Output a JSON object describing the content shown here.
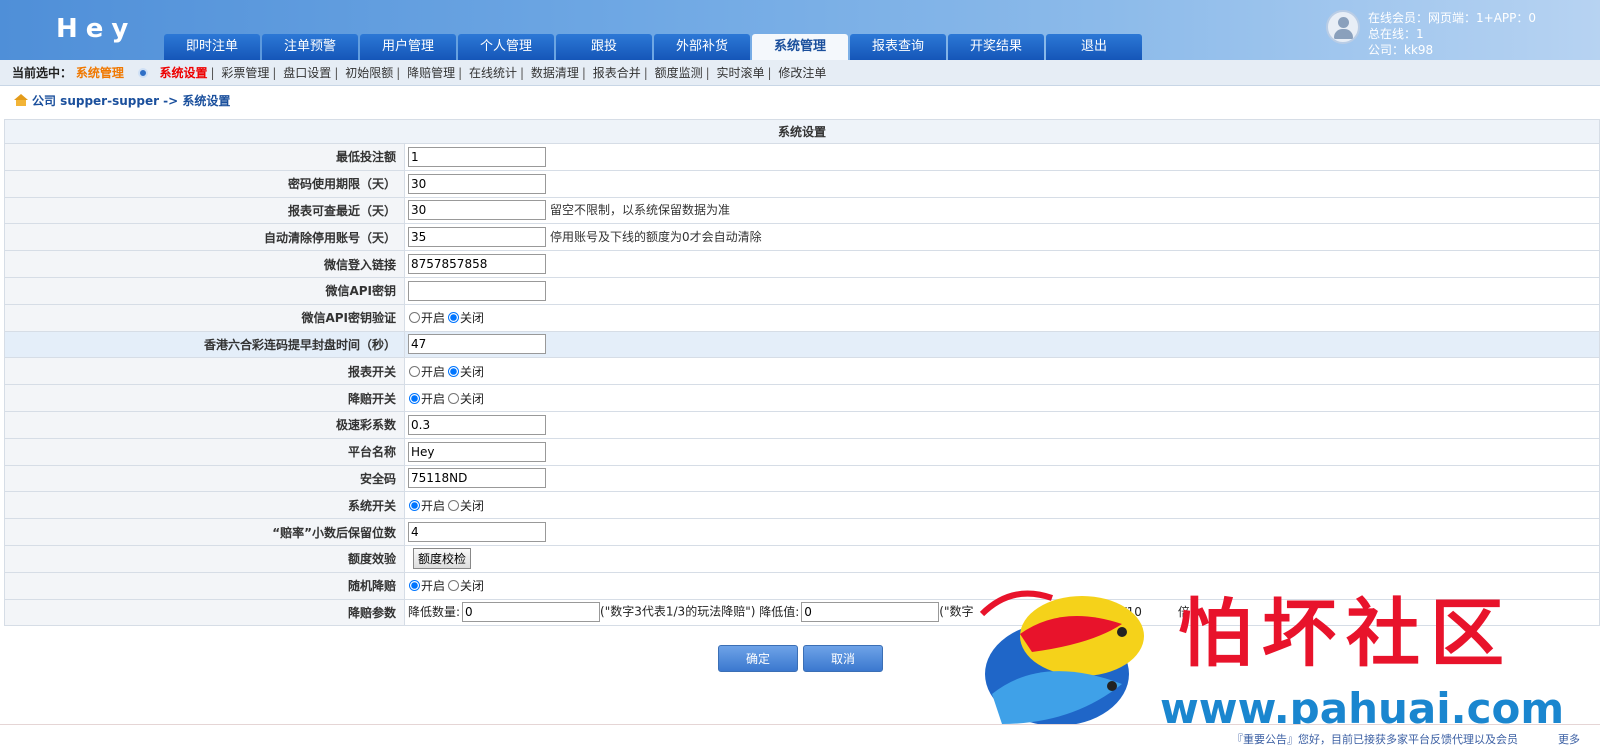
{
  "header": {
    "logo": "Hey",
    "nav_tabs": [
      "即时注单",
      "注单预警",
      "用户管理",
      "个人管理",
      "跟投",
      "外部补货",
      "系统管理",
      "报表查询",
      "开奖结果",
      "退出"
    ],
    "active_tab": "系统管理",
    "user_info": {
      "online_members": "在线会员：网页端：1+APP：0",
      "total_online": "总在线：1",
      "company": "公司：kk98"
    }
  },
  "subnav": {
    "current_label": "当前选中：",
    "current_value": "系统管理",
    "items": [
      "系统设置",
      "彩票管理",
      "盘口设置",
      "初始限额",
      "降赔管理",
      "在线统计",
      "数据清理",
      "报表合并",
      "额度监测",
      "实时滚单",
      "修改注单"
    ],
    "active_item": "系统设置"
  },
  "breadcrumb": "公司 supper-supper -> 系统设置",
  "settings": {
    "title": "系统设置",
    "rows": {
      "min_bet": {
        "label": "最低投注额",
        "value": "1"
      },
      "pwd_expire": {
        "label": "密码使用期限（天）",
        "value": "30"
      },
      "report_days": {
        "label": "报表可查最近（天）",
        "value": "30",
        "hint": "留空不限制，以系统保留数据为准"
      },
      "auto_clear": {
        "label": "自动清除停用账号（天）",
        "value": "35",
        "hint": "停用账号及下线的额度为0才会自动清除"
      },
      "wechat_link": {
        "label": "微信登入链接",
        "value": "8757857858"
      },
      "wechat_key": {
        "label": "微信API密钥",
        "value": ""
      },
      "wechat_verify": {
        "label": "微信API密钥验证",
        "on": "开启",
        "off": "关闭",
        "selected": "off"
      },
      "hk_close": {
        "label": "香港六合彩连码提早封盘时间（秒）",
        "value": "47"
      },
      "report_switch": {
        "label": "报表开关",
        "on": "开启",
        "off": "关闭",
        "selected": "off"
      },
      "odds_switch": {
        "label": "降赔开关",
        "on": "开启",
        "off": "关闭",
        "selected": "on"
      },
      "speed_factor": {
        "label": "极速彩系数",
        "value": "0.3"
      },
      "platform_name": {
        "label": "平台名称",
        "value": "Hey"
      },
      "security_code": {
        "label": "安全码",
        "value": "75118ND"
      },
      "system_switch": {
        "label": "系统开关",
        "on": "开启",
        "off": "关闭",
        "selected": "on"
      },
      "odds_decimals": {
        "label": "“赔率”小数后保留位数",
        "value": "4"
      },
      "quota_check": {
        "label": "额度效验",
        "button": "额度校检"
      },
      "random_odds": {
        "label": "随机降赔",
        "on": "开启",
        "off": "关闭",
        "selected": "on"
      },
      "odds_params": {
        "label": "降赔参数",
        "count_label": "降低数量:",
        "count_value": "0",
        "count_hint": "(\"数字3代表1/3的玩法降赔\")",
        "value_label": "降低值:",
        "value_value": "0",
        "value_hint": "(\"数字",
        "value_hint_tail": "10/10",
        "value_hint_end": "倍\")"
      }
    }
  },
  "actions": {
    "confirm": "确定",
    "cancel": "取消"
  },
  "footer": {
    "notice": "『重要公告』您好，目前已接获多家平台反馈代理以及会员",
    "more": "更多"
  },
  "watermark": {
    "text": "怕坏社区",
    "url": "www.pahuai.com"
  }
}
